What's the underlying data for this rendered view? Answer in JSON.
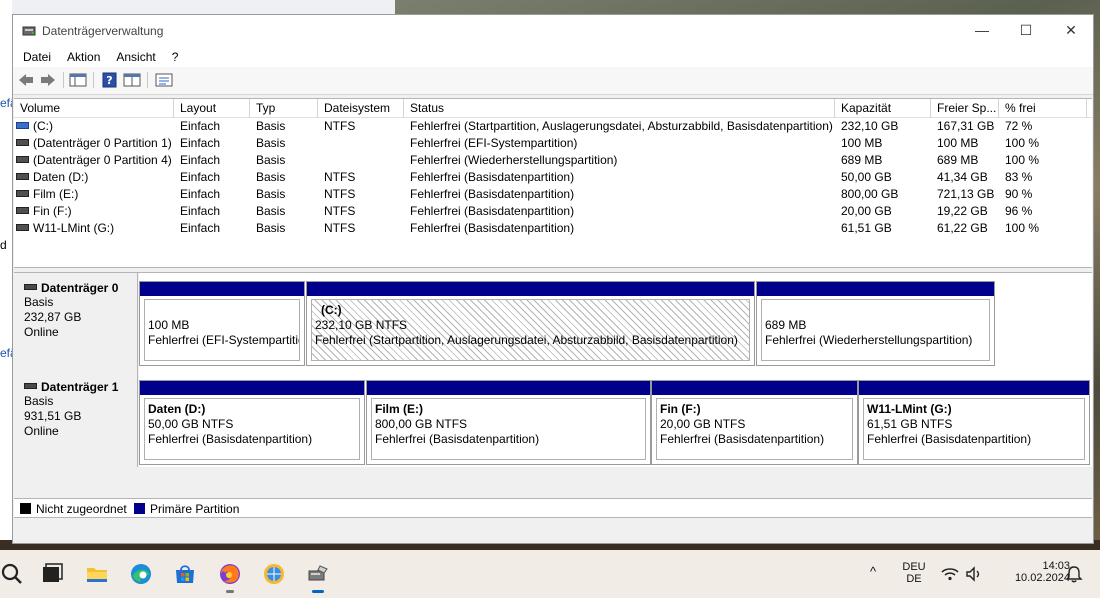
{
  "window": {
    "title": "Datenträgerverwaltung",
    "minimize": "—",
    "maximize": "☐",
    "close": "✕"
  },
  "background_text": [
    "efä",
    "d",
    "efä"
  ],
  "menu": [
    "Datei",
    "Aktion",
    "Ansicht",
    "?"
  ],
  "columns": [
    "Volume",
    "Layout",
    "Typ",
    "Dateisystem",
    "Status",
    "Kapazität",
    "Freier Sp...",
    "% frei"
  ],
  "volumes": [
    {
      "volume": "(C:)",
      "layout": "Einfach",
      "typ": "Basis",
      "fs": "NTFS",
      "status": "Fehlerfrei (Startpartition, Auslagerungsdatei, Absturzabbild, Basisdatenpartition)",
      "kap": "232,10 GB",
      "frei": "167,31 GB",
      "pct": "72 %",
      "icon": "system-volume-icon"
    },
    {
      "volume": "(Datenträger 0 Partition 1)",
      "layout": "Einfach",
      "typ": "Basis",
      "fs": "",
      "status": "Fehlerfrei (EFI-Systempartition)",
      "kap": "100 MB",
      "frei": "100 MB",
      "pct": "100 %",
      "icon": "volume-icon"
    },
    {
      "volume": "(Datenträger 0 Partition 4)",
      "layout": "Einfach",
      "typ": "Basis",
      "fs": "",
      "status": "Fehlerfrei (Wiederherstellungspartition)",
      "kap": "689 MB",
      "frei": "689 MB",
      "pct": "100 %",
      "icon": "volume-icon"
    },
    {
      "volume": "Daten (D:)",
      "layout": "Einfach",
      "typ": "Basis",
      "fs": "NTFS",
      "status": "Fehlerfrei (Basisdatenpartition)",
      "kap": "50,00 GB",
      "frei": "41,34 GB",
      "pct": "83 %",
      "icon": "volume-icon"
    },
    {
      "volume": "Film (E:)",
      "layout": "Einfach",
      "typ": "Basis",
      "fs": "NTFS",
      "status": "Fehlerfrei (Basisdatenpartition)",
      "kap": "800,00 GB",
      "frei": "721,13 GB",
      "pct": "90 %",
      "icon": "volume-icon"
    },
    {
      "volume": "Fin (F:)",
      "layout": "Einfach",
      "typ": "Basis",
      "fs": "NTFS",
      "status": "Fehlerfrei (Basisdatenpartition)",
      "kap": "20,00 GB",
      "frei": "19,22 GB",
      "pct": "96 %",
      "icon": "volume-icon"
    },
    {
      "volume": "W11-LMint (G:)",
      "layout": "Einfach",
      "typ": "Basis",
      "fs": "NTFS",
      "status": "Fehlerfrei (Basisdatenpartition)",
      "kap": "61,51 GB",
      "frei": "61,22 GB",
      "pct": "100 %",
      "icon": "volume-icon"
    }
  ],
  "disks": [
    {
      "name": "Datenträger 0",
      "type": "Basis",
      "size": "232,87 GB",
      "state": "Online",
      "partitions": [
        {
          "title": "",
          "size": "100 MB",
          "status": "Fehlerfrei (EFI-Systempartitio"
        },
        {
          "title": "(C:)",
          "size": "232,10 GB NTFS",
          "status": "Fehlerfrei (Startpartition, Auslagerungsdatei, Absturzabbild, Basisdatenpartition)"
        },
        {
          "title": "",
          "size": "689 MB",
          "status": "Fehlerfrei (Wiederherstellungspartition)"
        }
      ]
    },
    {
      "name": "Datenträger 1",
      "type": "Basis",
      "size": "931,51 GB",
      "state": "Online",
      "partitions": [
        {
          "title": "Daten  (D:)",
          "size": "50,00 GB NTFS",
          "status": "Fehlerfrei (Basisdatenpartition)"
        },
        {
          "title": "Film  (E:)",
          "size": "800,00 GB NTFS",
          "status": "Fehlerfrei (Basisdatenpartition)"
        },
        {
          "title": "Fin  (F:)",
          "size": "20,00 GB NTFS",
          "status": "Fehlerfrei (Basisdatenpartition)"
        },
        {
          "title": "W11-LMint  (G:)",
          "size": "61,51 GB NTFS",
          "status": "Fehlerfrei (Basisdatenpartition)"
        }
      ]
    }
  ],
  "legend": [
    {
      "label": "Nicht zugeordnet",
      "color": "#000000"
    },
    {
      "label": "Primäre Partition",
      "color": "#00008b"
    }
  ],
  "colors": {
    "primary_partition": "#00008b",
    "unallocated": "#000000"
  },
  "taskbar": {
    "lang_top": "DEU",
    "lang_bottom": "DE",
    "time": "14:03",
    "date": "10.02.2024",
    "chevron": "^"
  }
}
